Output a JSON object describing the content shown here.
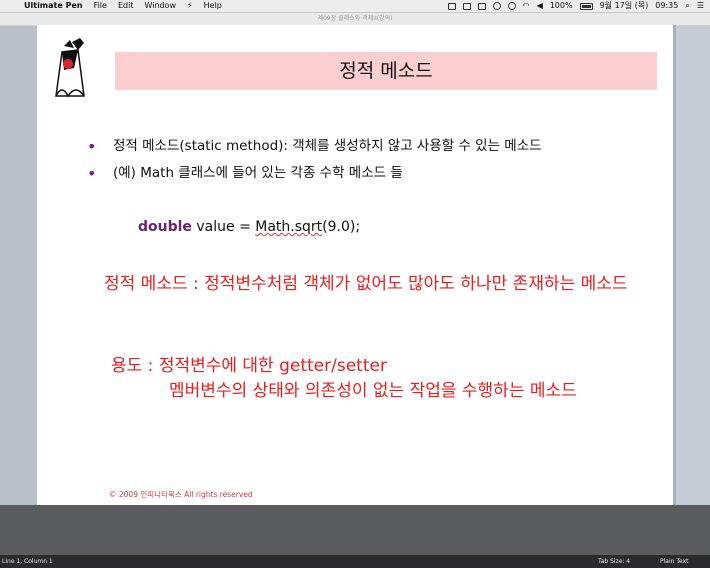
{
  "menubar": {
    "apple": "",
    "app_name": "Ultimate Pen",
    "menus": [
      "File",
      "Edit",
      "Window"
    ],
    "bolt": "⚡",
    "help": "Help",
    "battery": "100%",
    "date": "9월 17일 (목)",
    "time": "09:35"
  },
  "window": {
    "title": "제09장 클래스와 객체II(강의)"
  },
  "slide": {
    "title": "정적 메소드",
    "bullets": [
      "정적 메소드(static method): 객체를 생성하지 않고 사용할 수 있는 메소드",
      "(예) Math 클래스에 들어 있는 각종 수학 메소드 들"
    ],
    "code": {
      "keyword": "double",
      "text_before": " value = ",
      "call": "Math.sqrt",
      "text_after": "(9.0);"
    },
    "note1": "정적 메소드 : 정적변수처럼 객체가 없어도 많아도 하나만 존재하는 메소드",
    "note2_line1": "용도 : 정적변수에 대한 getter/setter",
    "note2_line2": "멤버변수의 상태와 의존성이 없는 작업을 수행하는 메소드",
    "copyright": "© 2009 인피니티북스 All rights reserved"
  },
  "status": {
    "position": "Line 1, Column 1",
    "tab_size": "Tab Size: 4",
    "syntax": "Plain Text"
  },
  "colors": {
    "title_bg": "#fcced0",
    "note_red": "#ee1c1c",
    "bullet_purple": "#7a1fa2",
    "keyword_purple": "#6d1e7a"
  }
}
